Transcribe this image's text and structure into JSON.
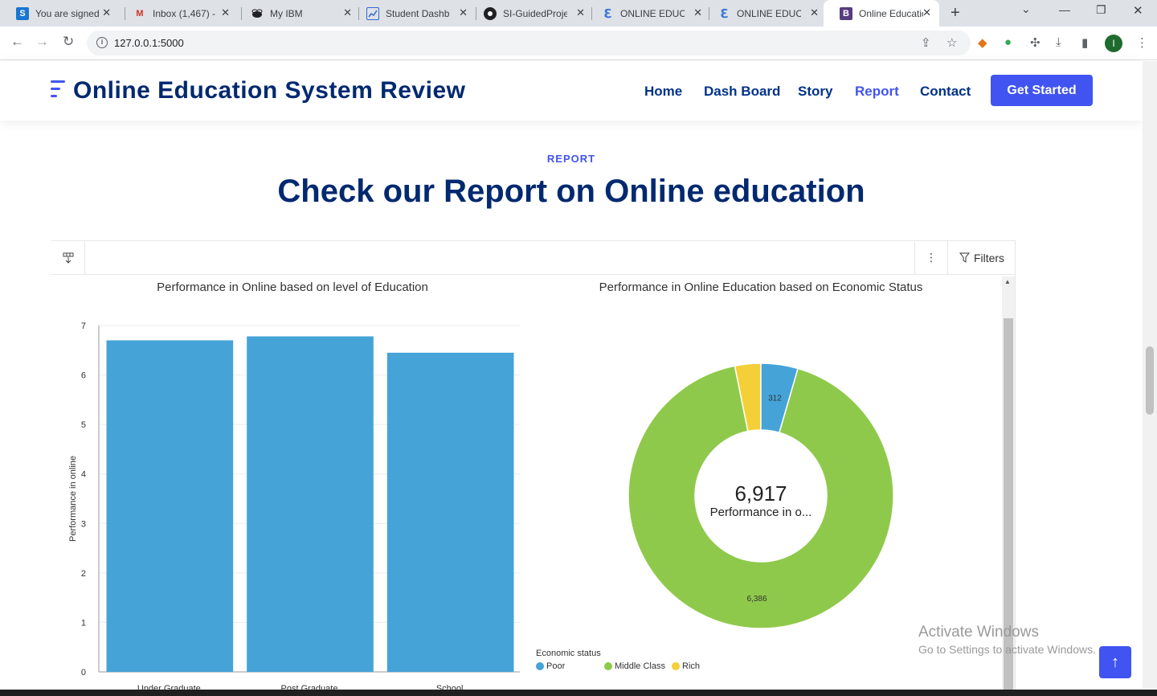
{
  "browser": {
    "tabs": [
      {
        "title": "You are signed",
        "favicon": "S",
        "color": "#1976d2"
      },
      {
        "title": "Inbox (1,467) -",
        "favicon": "M",
        "color": "#d93025"
      },
      {
        "title": "My IBM",
        "favicon": "bee",
        "color": "#202124"
      },
      {
        "title": "Student Dashb",
        "favicon": "chart",
        "color": "#3367d6"
      },
      {
        "title": "SI-GuidedProje",
        "favicon": "github",
        "color": "#202124"
      },
      {
        "title": "ONLINE EDUCA",
        "favicon": "e",
        "color": "#3c78d8"
      },
      {
        "title": "ONLINE EDUCA",
        "favicon": "e",
        "color": "#3c78d8"
      },
      {
        "title": "Online Educatio",
        "favicon": "B",
        "color": "#563d7c"
      }
    ],
    "url": "127.0.0.1:5000",
    "profile_initial": "I"
  },
  "site": {
    "logo": "Online Education System Review",
    "nav": [
      "Home",
      "Dash Board",
      "Story",
      "Report",
      "Contact"
    ],
    "active_nav": "Report",
    "cta": "Get Started",
    "section_tag": "REPORT",
    "section_title": "Check our Report on Online education"
  },
  "dashboard": {
    "filters_label": "Filters"
  },
  "chart_data": [
    {
      "type": "bar",
      "title": "Performance in Online based on level of Education",
      "xlabel": "",
      "ylabel": "Performance in online",
      "categories": [
        "Under Graduate",
        "Post Graduate",
        "School"
      ],
      "values": [
        6.7,
        6.78,
        6.45
      ],
      "ylim": [
        0,
        7
      ],
      "yticks": [
        "0",
        "1",
        "2",
        "3",
        "4",
        "5",
        "6",
        "7"
      ],
      "color": "#45a3d8",
      "grid": true
    },
    {
      "type": "pie",
      "title": "Performance in Online Education based on Economic Status",
      "center_value": "6,917",
      "center_label": "Performance in o...",
      "legend_title": "Economic status",
      "slices": [
        {
          "label": "Poor",
          "value": 312,
          "display": "312",
          "color": "#45a3d8"
        },
        {
          "label": "Middle Class",
          "value": 6386,
          "display": "6,386",
          "color": "#8fc94b"
        },
        {
          "label": "Rich",
          "value": 219,
          "display": "",
          "color": "#f4cf38"
        }
      ]
    }
  ],
  "watermark": {
    "line1": "Activate Windows",
    "line2": "Go to Settings to activate Windows."
  }
}
